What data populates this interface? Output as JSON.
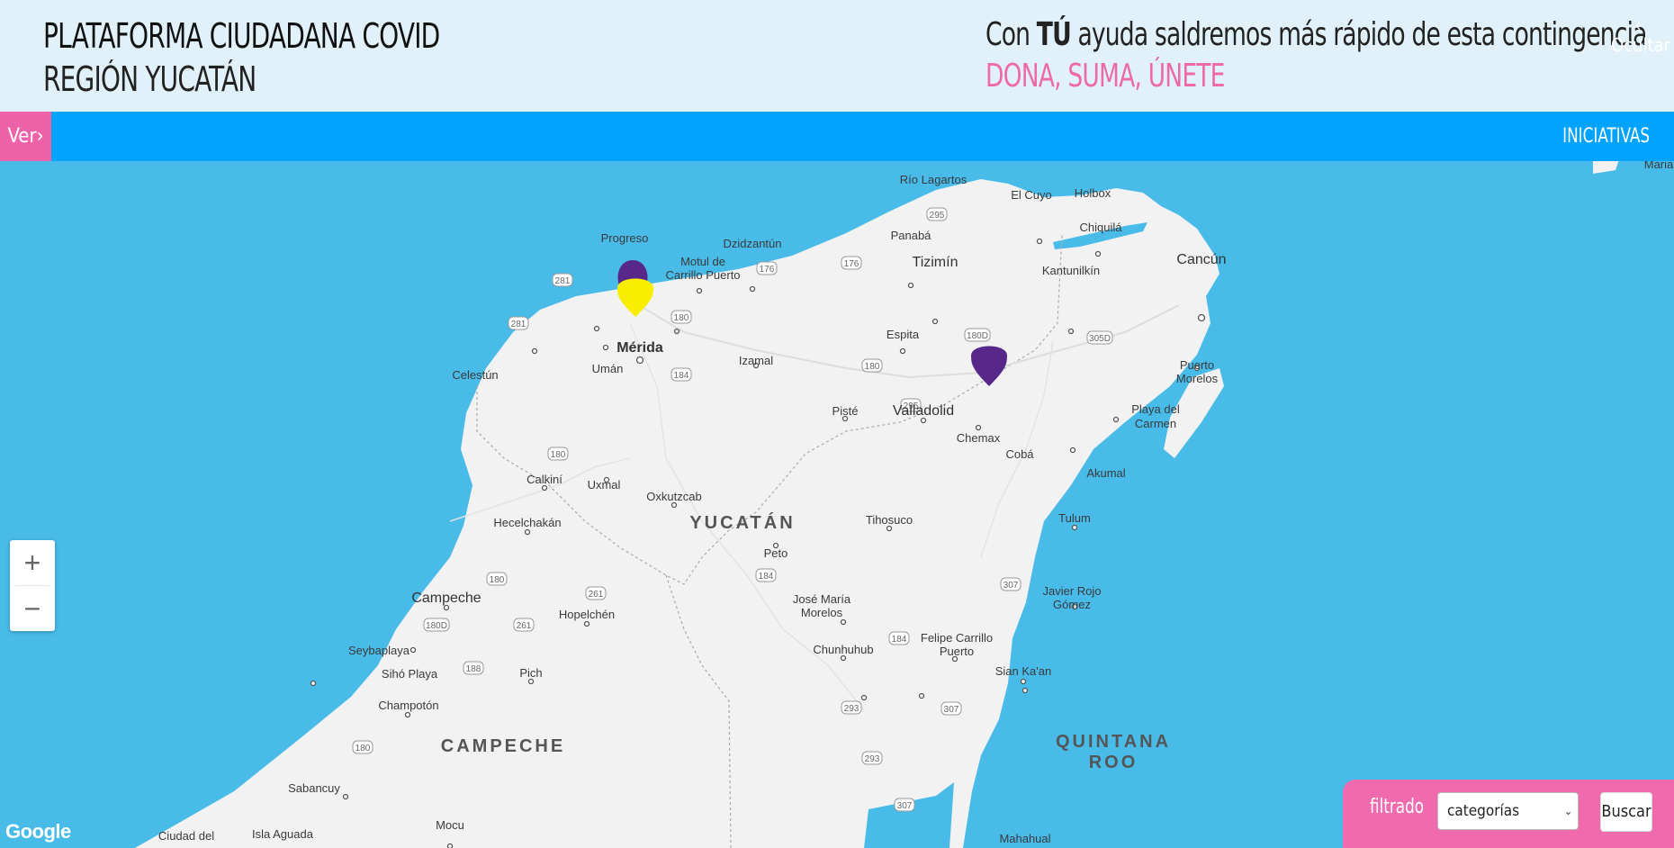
{
  "header": {
    "title_line1": "PLATAFORMA CIUDADANA COVID",
    "title_line2": "REGIÓN YUCATÁN",
    "slogan_pre": "Con ",
    "slogan_bold": "TÚ",
    "slogan_post": " ayuda saldremos más rápido de esta contingencia",
    "cta": "DONA, SUMA, ÚNETE",
    "hide_label": "Ocultar"
  },
  "nav": {
    "ver_label": "Ver",
    "link_label": "INICIATIVAS"
  },
  "map": {
    "attribution": "Google",
    "labels": {
      "rio_lagartos": "Río Lagartos",
      "el_cuyo": "El Cuyo",
      "holbox": "Holbox",
      "chiquila": "Chiquilá",
      "progreso": "Progreso",
      "dzidzantun": "Dzidzantún",
      "panaba": "Panabá",
      "motul1": "Motul de",
      "motul2": "Carrillo Puerto",
      "tizimin": "Tizimín",
      "kantunilkin": "Kantunilkín",
      "cancun": "Cancún",
      "merida": "Mérida",
      "espita": "Espita",
      "celestun": "Celestún",
      "uman": "Umán",
      "izamal": "Izamal",
      "puerto_morelos1": "Puerto",
      "puerto_morelos2": "Morelos",
      "piste": "Pisté",
      "valladolid": "Valladolid",
      "playa1": "Playa del",
      "playa2": "Carmen",
      "chemax": "Chemax",
      "coba": "Cobá",
      "calkini": "Calkiní",
      "uxmal": "Uxmal",
      "oxkutzcab": "Oxkutzcab",
      "akumal": "Akumal",
      "hecelchakan": "Hecelchakán",
      "yucatan": "YUCATÁN",
      "tihosuco": "Tihosuco",
      "tulum": "Tulum",
      "peto": "Peto",
      "campeche_city": "Campeche",
      "jose_maria1": "José María",
      "jose_maria2": "Morelos",
      "javier1": "Javier Rojo",
      "javier2": "Gómez",
      "hopelchen": "Hopelchén",
      "seybaplaya": "Seybaplaya",
      "chunhuhub": "Chunhuhub",
      "felipe1": "Felipe Carrillo",
      "felipe2": "Puerto",
      "siho": "Sihó Playa",
      "pich": "Pich",
      "sian_kaan": "Sian Ka'an",
      "champoton": "Champotón",
      "campeche_state": "CAMPECHE",
      "quintana1": "QUINTANA",
      "quintana2": "ROO",
      "sabancuy": "Sabancuy",
      "ciudad_del": "Ciudad del",
      "isla_aguada": "Isla Aguada",
      "mocu": "Mocu",
      "mahahual": "Mahahual",
      "maria": "Maria"
    },
    "shields": [
      "295",
      "176",
      "176",
      "281",
      "281",
      "180",
      "180D",
      "180",
      "184",
      "295",
      "180",
      "305D",
      "180",
      "261",
      "180D",
      "261",
      "184",
      "307",
      "184",
      "188",
      "293",
      "307",
      "293",
      "180",
      "307"
    ]
  },
  "filter": {
    "label": "filtrado",
    "select_value": "categorías",
    "button": "Buscar"
  },
  "colors": {
    "header_bg": "#e1f1fa",
    "nav_bg": "#00a3fe",
    "accent_pink": "#ee62a9",
    "water": "#48bbe9",
    "land": "#f2f2f2",
    "marker_purple": "#58278a",
    "marker_yellow": "#f9ee00"
  }
}
